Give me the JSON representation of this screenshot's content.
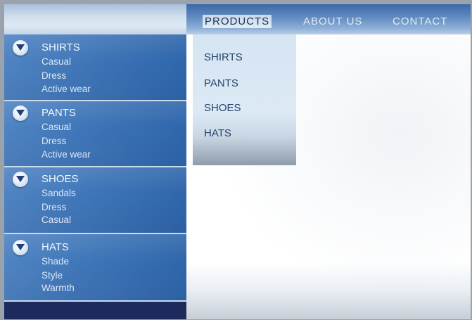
{
  "nav": {
    "items": [
      {
        "label": "PRODUCTS",
        "active": true
      },
      {
        "label": "ABOUT US",
        "active": false
      },
      {
        "label": "CONTACT",
        "active": false
      }
    ]
  },
  "dropdown": {
    "items": [
      {
        "label": "SHIRTS"
      },
      {
        "label": "PANTS"
      },
      {
        "label": "SHOES"
      },
      {
        "label": "HATS"
      }
    ]
  },
  "sidebar": {
    "groups": [
      {
        "title": "SHIRTS",
        "icon": "chevron-down-icon",
        "subs": [
          "Casual",
          "Dress",
          "Active wear"
        ]
      },
      {
        "title": "PANTS",
        "icon": "chevron-down-icon",
        "subs": [
          "Casual",
          "Dress",
          "Active wear"
        ]
      },
      {
        "title": "SHOES",
        "icon": "chevron-down-icon",
        "subs": [
          "Sandals",
          "Dress",
          "Casual"
        ]
      },
      {
        "title": "HATS",
        "icon": "chevron-down-icon",
        "subs": [
          "Shade",
          "Style",
          "Warmth"
        ]
      }
    ]
  },
  "colors": {
    "sidebar_blue": "#3f76b8",
    "sidebar_footer": "#1c2a5c",
    "nav_text": "#dfeaf6",
    "dropdown_text": "#24446e"
  }
}
